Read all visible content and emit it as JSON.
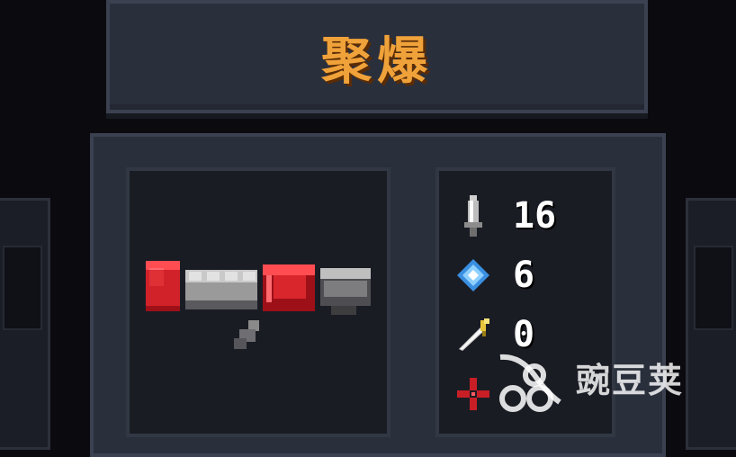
{
  "weapon": {
    "name": "聚爆",
    "name_color": "#f0a23a"
  },
  "stats": [
    {
      "icon": "sword-damage-icon",
      "value": "16"
    },
    {
      "icon": "blue-crystal-energy-icon",
      "value": "6"
    },
    {
      "icon": "critical-dagger-icon",
      "value": "0"
    },
    {
      "icon": "red-crosshair-icon",
      "value": ""
    }
  ],
  "watermark": {
    "logo": "wandoujia-logo",
    "text": "豌豆荚"
  },
  "colors": {
    "panel": "#2a2f3c",
    "inner": "#1a1c24",
    "weapon_red": "#d9262d",
    "weapon_gray": "#9a9a9a"
  }
}
